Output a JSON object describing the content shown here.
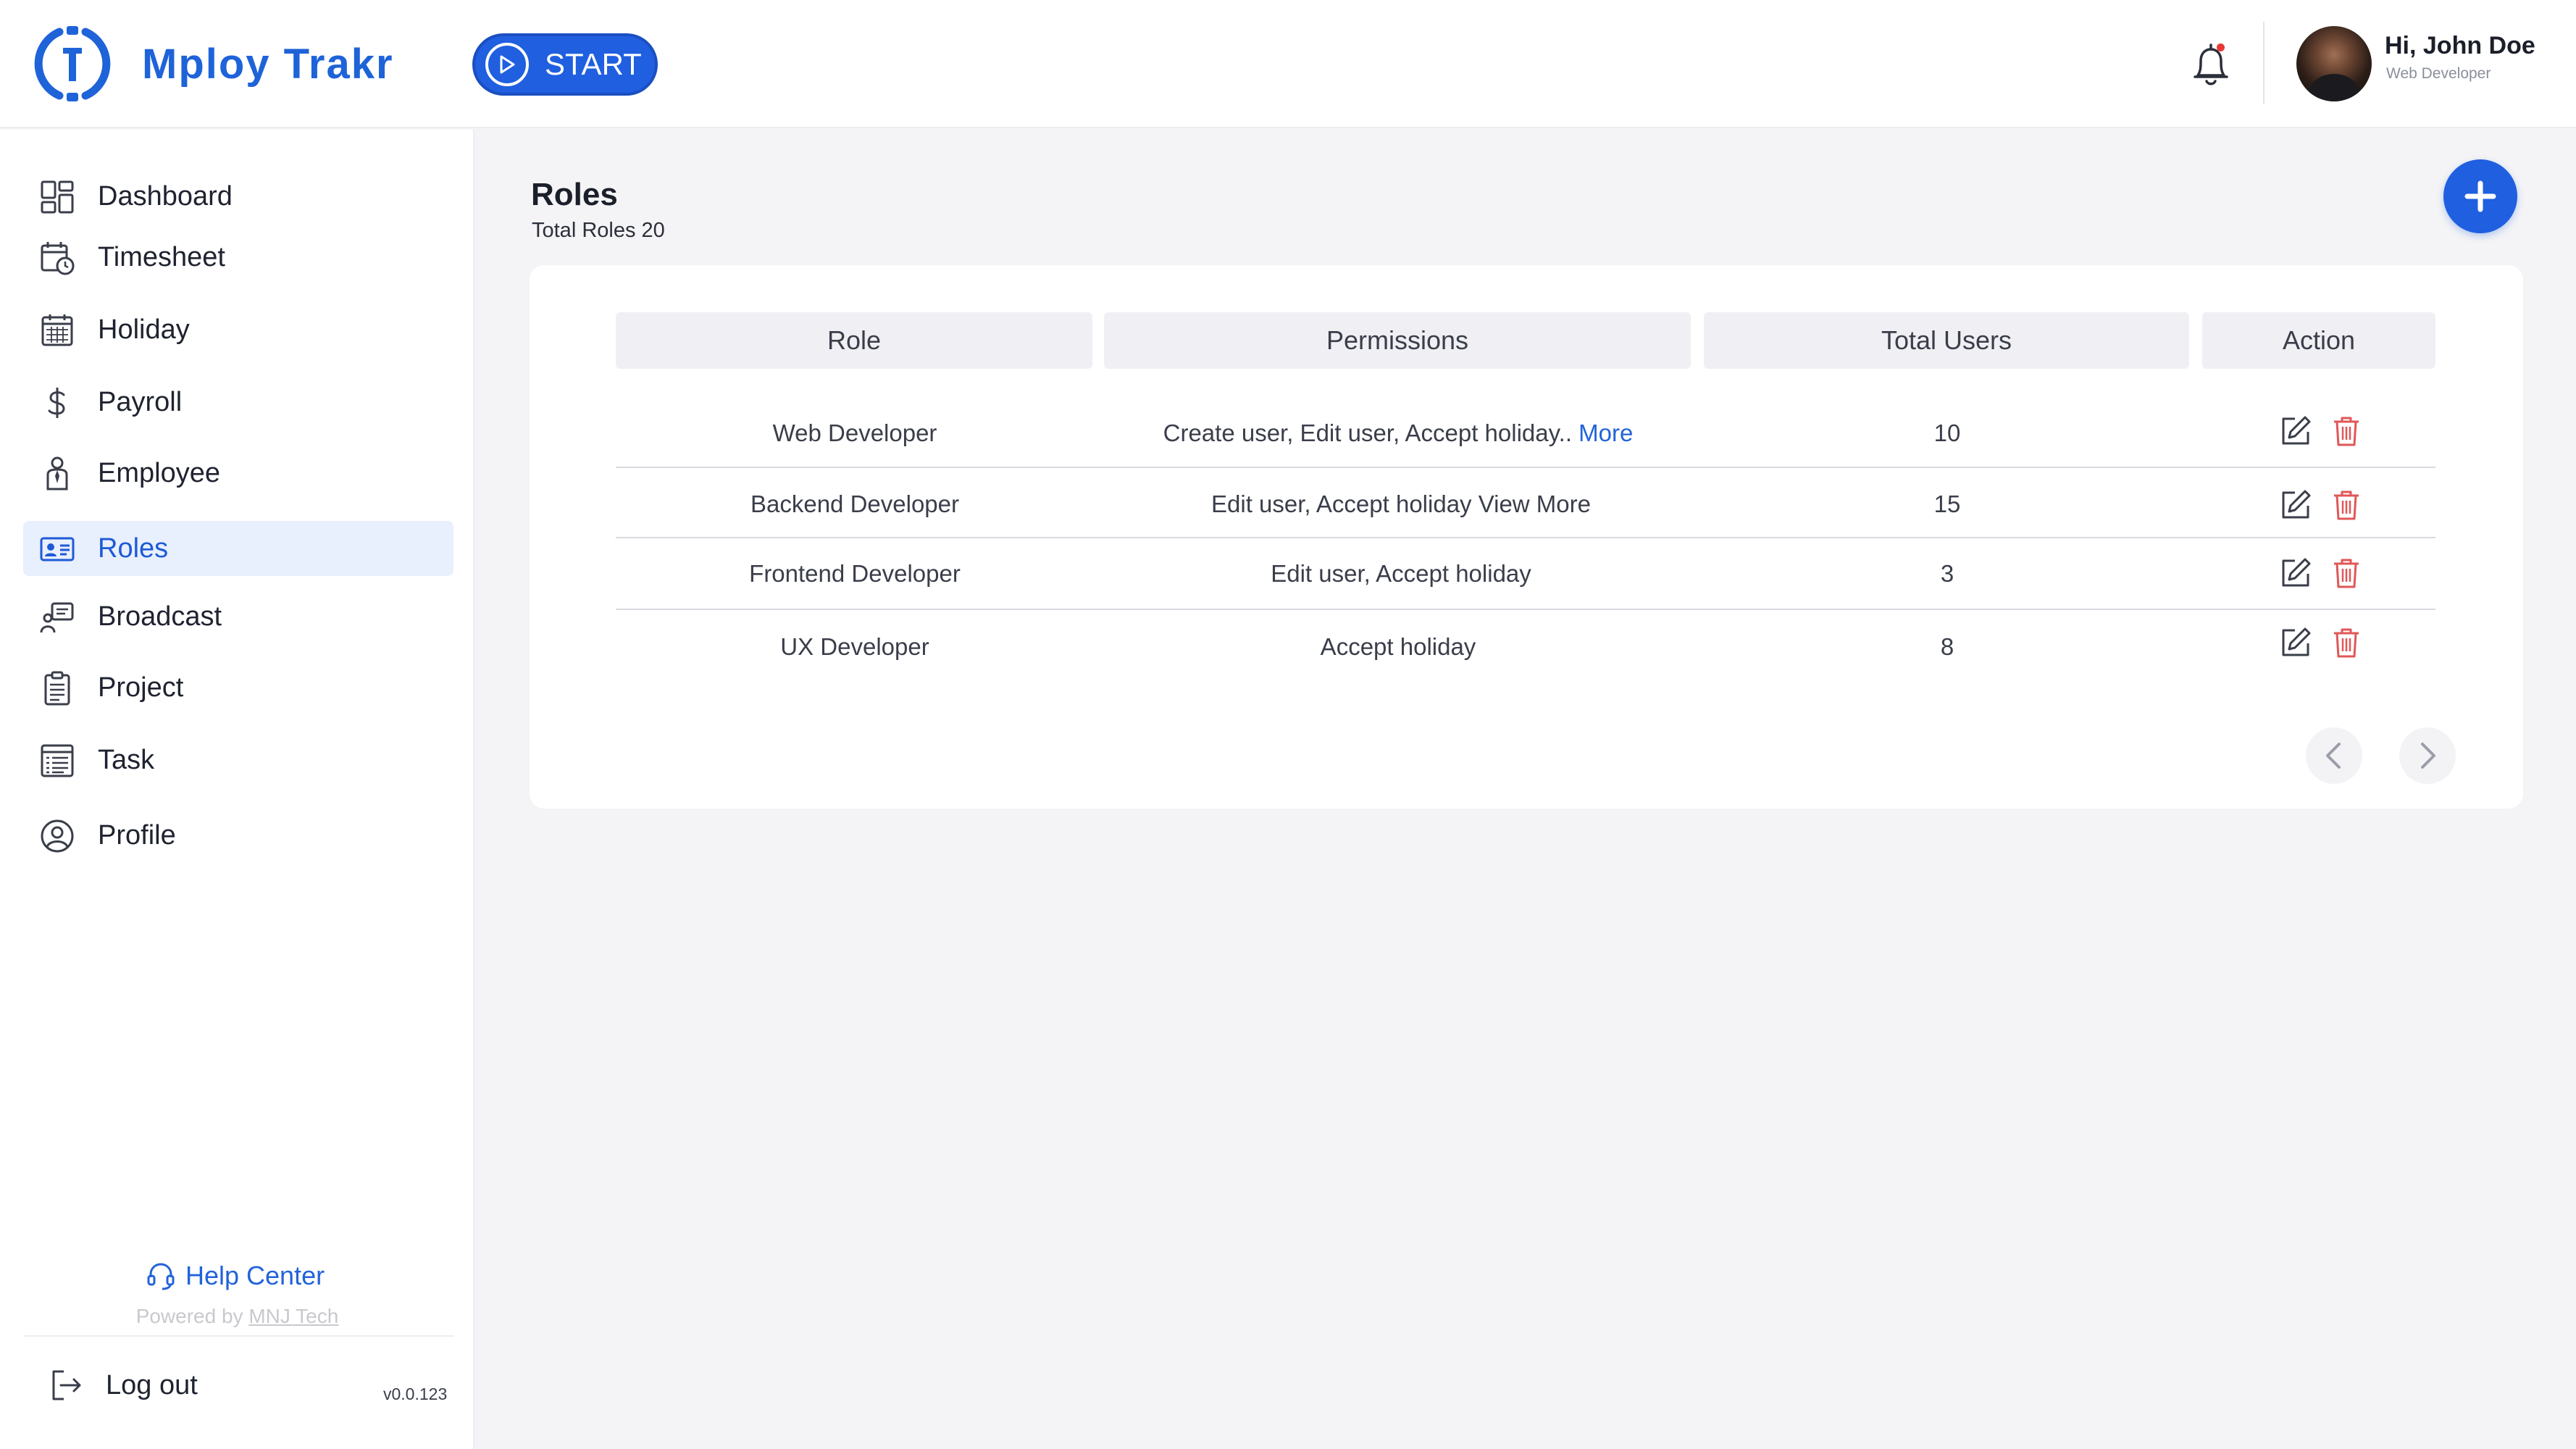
{
  "app": {
    "logo_text": "Mploy Trakr"
  },
  "header": {
    "start_label": "START",
    "user_greeting": "Hi, John Doe",
    "user_role": "Web Developer"
  },
  "sidebar": {
    "items": [
      {
        "label": "Dashboard",
        "icon": "dashboard-icon"
      },
      {
        "label": "Timesheet",
        "icon": "timesheet-icon"
      },
      {
        "label": "Holiday",
        "icon": "calendar-icon"
      },
      {
        "label": "Payroll",
        "icon": "dollar-icon"
      },
      {
        "label": "Employee",
        "icon": "employee-icon"
      },
      {
        "label": "Roles",
        "icon": "id-card-icon",
        "active": true
      },
      {
        "label": "Broadcast",
        "icon": "broadcast-icon"
      },
      {
        "label": "Project",
        "icon": "clipboard-icon"
      },
      {
        "label": "Task",
        "icon": "task-list-icon"
      },
      {
        "label": "Profile",
        "icon": "user-circle-icon"
      }
    ],
    "help_label": "Help Center",
    "powered_prefix": "Powered by ",
    "powered_link": "MNJ Tech",
    "logout_label": "Log out",
    "version": "v0.0.123"
  },
  "main": {
    "title": "Roles",
    "subtitle": "Total Roles 20"
  },
  "table": {
    "headers": [
      "Role",
      "Permissions",
      "Total Users",
      "Action"
    ],
    "rows": [
      {
        "role": "Web Developer",
        "permissions": "Create user, Edit user, Accept holiday..",
        "more": "More",
        "users": "10"
      },
      {
        "role": "Backend Developer",
        "permissions": "Edit user, Accept holiday View More",
        "more": "",
        "users": "15"
      },
      {
        "role": "Frontend Developer",
        "permissions": "Edit user, Accept holiday",
        "more": "",
        "users": "3"
      },
      {
        "role": "UX Developer",
        "permissions": "Accept holiday",
        "more": "",
        "users": "8"
      }
    ]
  },
  "colors": {
    "accent": "#1f5fe0",
    "delete": "#e05757",
    "active_bg": "#e8effd"
  }
}
